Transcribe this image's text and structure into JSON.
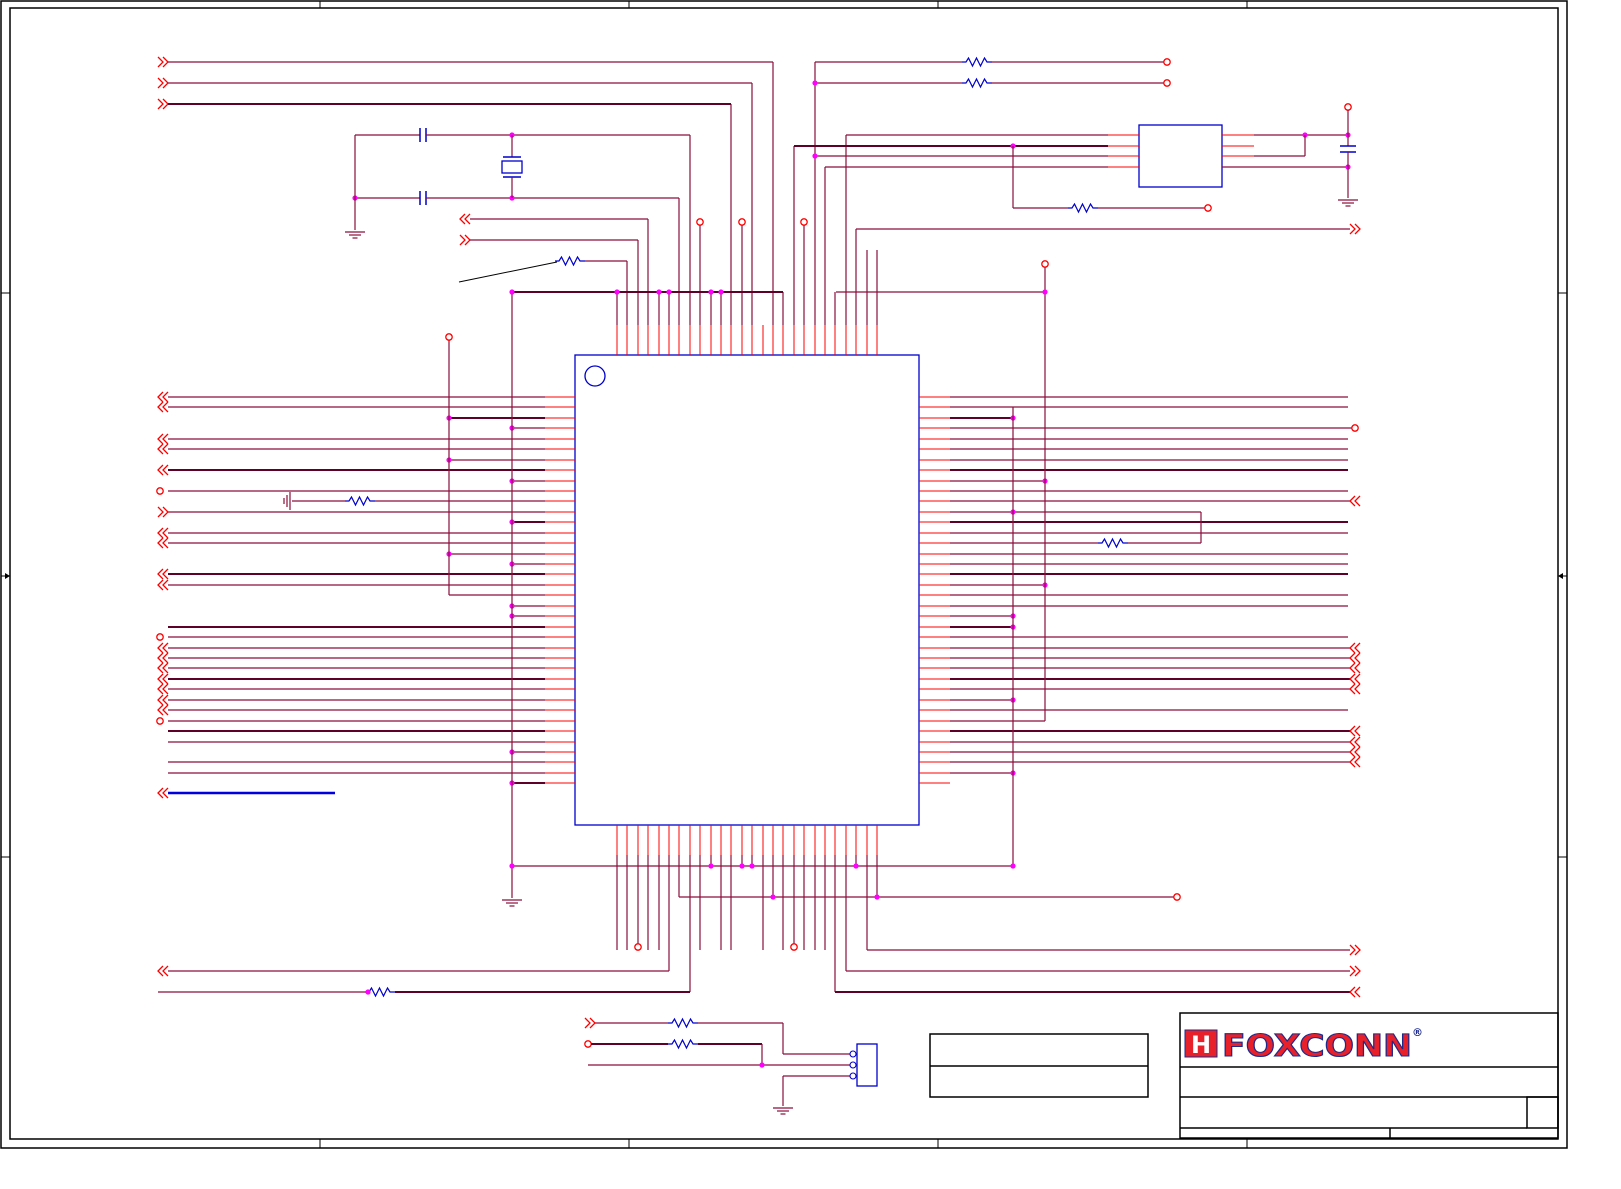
{
  "title_block": {
    "logo_mark": "H",
    "logo_text": "FOXCONN",
    "registered_mark": "®"
  },
  "colors": {
    "pin": "#ff0000",
    "wire": "#8a0f3a",
    "wire_heavy": "#5e0028",
    "junction": "#ff00ff",
    "component": "#0000cc",
    "bus": "#0000dd",
    "frame": "#000000",
    "logo_red": "#e8202a",
    "logo_outline": "#1c2a8c"
  },
  "icons": {
    "off_page_out": "double-chevron-right-icon",
    "off_page_in": "double-chevron-left-icon",
    "terminal": "open-circle-icon",
    "ground": "ground-icon",
    "resistor": "resistor-icon",
    "capacitor": "capacitor-icon",
    "crystal": "crystal-icon"
  }
}
